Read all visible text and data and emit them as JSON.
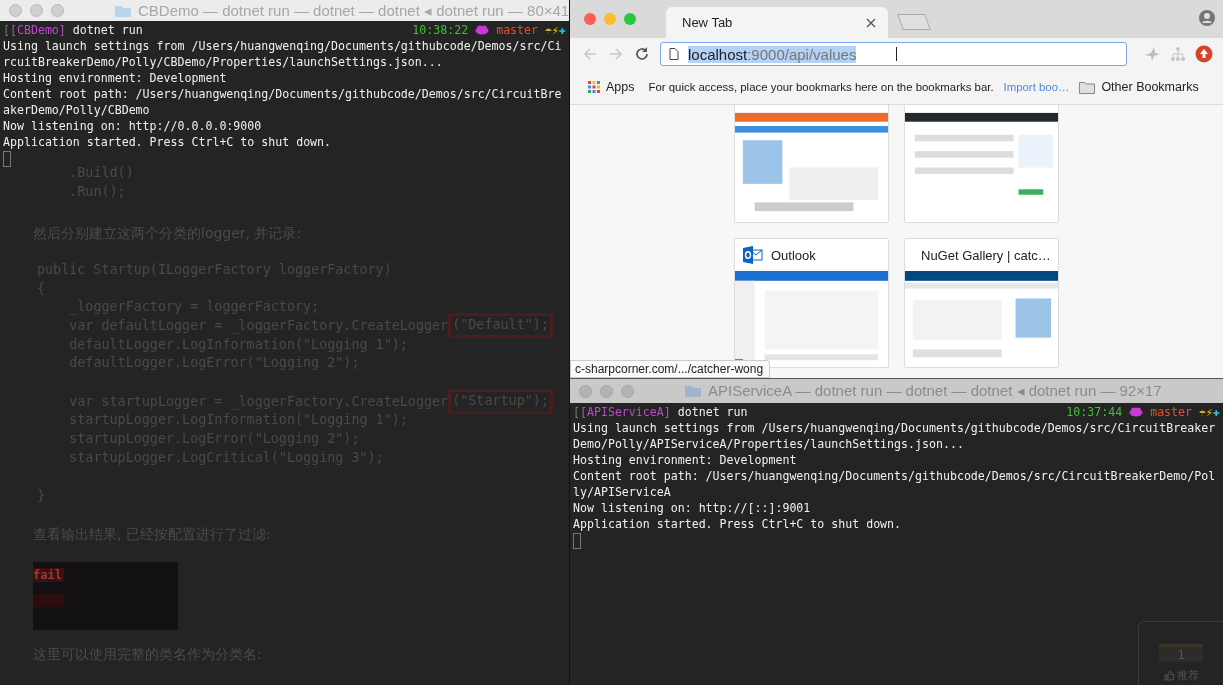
{
  "left_terminal": {
    "title": "CBDemo — dotnet run — dotnet — dotnet ◂ dotnet run — 80×41",
    "prompt": {
      "prefix": "[",
      "dir": "[CBDemo]",
      "command": "dotnet run",
      "time": "10:38:22",
      "branch": "master",
      "marks": [
        "☂",
        "⚡",
        "✚"
      ]
    },
    "lines": [
      "Using launch settings from /Users/huangwenqing/Documents/githubcode/Demos/src/Ci",
      "rcuitBreakerDemo/Polly/CBDemo/Properties/launchSettings.json...",
      "Hosting environment: Development",
      "Content root path: /Users/huangwenqing/Documents/githubcode/Demos/src/CircuitBre",
      "akerDemo/Polly/CBDemo",
      "Now listening on: http://0.0.0.0:9000",
      "Application started. Press Ctrl+C to shut down."
    ]
  },
  "background_article": {
    "blocks": [
      {
        "kind": "code",
        "lines": [
          {
            "text": "    .Build()"
          },
          {
            "text": "    .Run();"
          }
        ]
      },
      {
        "kind": "para",
        "text": "然后分别建立这两个分类的logger, 并记录:"
      },
      {
        "kind": "code",
        "lines": [
          {
            "text": "public Startup(ILoggerFactory loggerFactory)"
          },
          {
            "text": "{"
          },
          {
            "text": "    _loggerFactory = loggerFactory;"
          },
          {
            "text": "    var defaultLogger = _loggerFactory.CreateLogger",
            "boxed": "(\"Default\");"
          },
          {
            "text": "    defaultLogger.LogInformation(\"Logging 1\");"
          },
          {
            "text": "    defaultLogger.LogError(\"Logging 2\");"
          }
        ]
      },
      {
        "kind": "code",
        "lines": [
          {
            "text": "    var startupLogger = _loggerFactory.CreateLogger",
            "boxed": "(\"Startup\");"
          },
          {
            "text": "    startupLogger.LogInformation(\"Logging 1\");"
          },
          {
            "text": "    startupLogger.LogError(\"Logging 2\");"
          },
          {
            "text": "    startupLogger.LogCritical(\"Logging 3\");"
          }
        ]
      },
      {
        "kind": "code",
        "lines": [
          {
            "text": "}"
          }
        ]
      },
      {
        "kind": "para",
        "text": "查看输出结果, 已经按配置进行了过滤:"
      },
      {
        "kind": "output",
        "text": "fail"
      },
      {
        "kind": "para",
        "text": "这里可以使用完整的类名作为分类名:"
      }
    ]
  },
  "browser": {
    "tabs": [
      {
        "label": "New Tab",
        "selected": true
      }
    ],
    "url": {
      "host": "localhost",
      "rest": ":9000/api/values"
    },
    "bookmarks_bar": {
      "apps": "Apps",
      "hint": "For quick access, place your bookmarks here on the bookmarks bar.",
      "import_link": "Import boo…",
      "other": "Other Bookmarks"
    },
    "tiles": [
      {
        "kind": "cut"
      },
      {
        "kind": "cut"
      },
      {
        "kind": "full",
        "title": "Outlook"
      },
      {
        "kind": "full",
        "title": "NuGet Gallery | catc…"
      }
    ],
    "status_bubble": "c-sharpcorner.com/.../catcher-wong"
  },
  "right_terminal": {
    "title": "APIServiceA — dotnet run — dotnet — dotnet ◂ dotnet run — 92×17",
    "prompt": {
      "prefix": "[",
      "dir": "[APIServiceA]",
      "command": "dotnet run",
      "time": "10:37:44",
      "branch": "master",
      "marks": [
        "☂",
        "⚡",
        "✚"
      ]
    },
    "lines": [
      "Using launch settings from /Users/huangwenqing/Documents/githubcode/Demos/src/CircuitBreaker",
      "Demo/Polly/APIServiceA/Properties/launchSettings.json...",
      "Hosting environment: Development",
      "Content root path: /Users/huangwenqing/Documents/githubcode/Demos/src/CircuitBreakerDemo/Pol",
      "ly/APIServiceA",
      "Now listening on: http://[::]:9001",
      "Application started. Press Ctrl+C to shut down."
    ]
  },
  "recommend_widget": {
    "count": "1",
    "label": "推荐"
  }
}
